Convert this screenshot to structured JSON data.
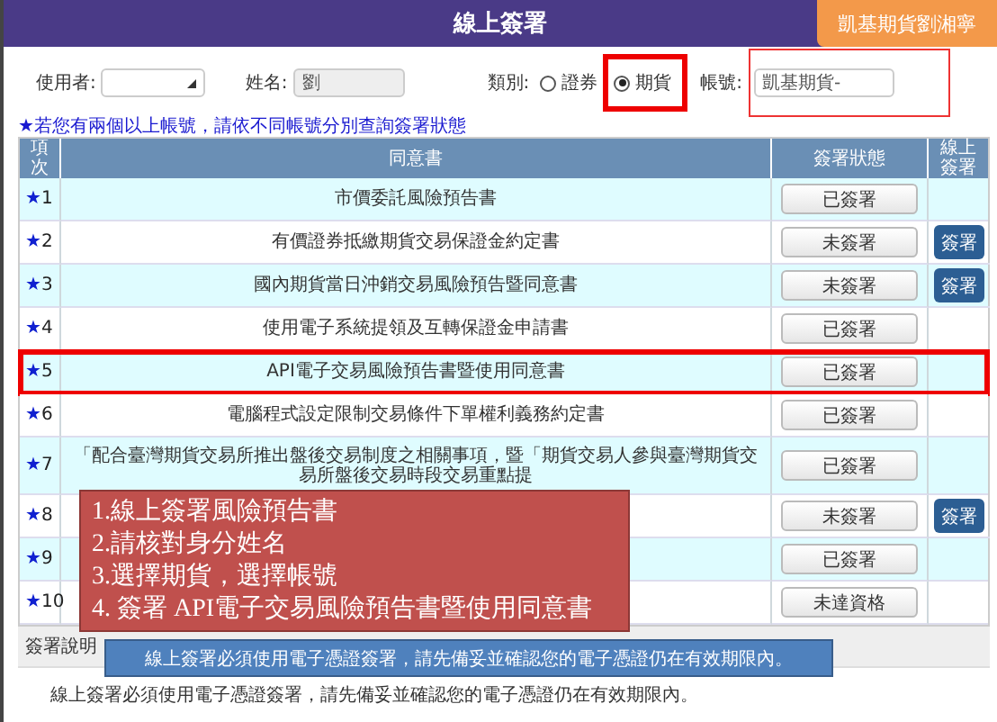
{
  "header": {
    "title": "線上簽署",
    "badge": "凱基期貨劉湘寧"
  },
  "form": {
    "user_label": "使用者:",
    "name_label": "姓名:",
    "name_value": "劉",
    "category_label": "類別:",
    "categories": [
      {
        "label": "證券",
        "selected": false,
        "highlighted": false
      },
      {
        "label": "期貨",
        "selected": true,
        "highlighted": true
      }
    ],
    "account_label": "帳號:",
    "account_value": "凱基期貨-",
    "account_highlighted": true
  },
  "note": "★若您有兩個以上帳號，請依不同帳號分別查詢簽署狀態",
  "table": {
    "columns": [
      "項次",
      "同意書",
      "簽署狀態",
      "線上簽署"
    ],
    "rows": [
      {
        "marker": "★",
        "index": "1",
        "document": "市價委託風險預告書",
        "status": "已簽署",
        "highlighted": false
      },
      {
        "marker": "★",
        "index": "2",
        "document": "有價證券抵繳期貨交易保證金約定書",
        "status": "未簽署",
        "action": "簽署",
        "highlighted": false
      },
      {
        "marker": "★",
        "index": "3",
        "document": "國內期貨當日沖銷交易風險預告暨同意書",
        "status": "未簽署",
        "action": "簽署",
        "highlighted": false
      },
      {
        "marker": "★",
        "index": "4",
        "document": "使用電子系統提領及互轉保證金申請書",
        "status": "已簽署",
        "highlighted": false
      },
      {
        "marker": "★",
        "index": "5",
        "document": "API電子交易風險預告書暨使用同意書",
        "status": "已簽署",
        "highlighted": true
      },
      {
        "marker": "★",
        "index": "6",
        "document": "電腦程式設定限制交易條件下單權利義務約定書",
        "status": "已簽署",
        "highlighted": false
      },
      {
        "marker": "★",
        "index": "7",
        "document": "「配合臺灣期貨交易所推出盤後交易制度之相關事項，暨「期貨交易人參與臺灣期貨交易所盤後交易時段交易重點提",
        "status": "已簽署",
        "highlighted": false
      },
      {
        "marker": "★",
        "index": "8",
        "status": "未簽署",
        "action": "簽署",
        "highlighted": false
      },
      {
        "marker": "★",
        "index": "9",
        "status": "已簽署",
        "highlighted": false
      },
      {
        "marker": "★",
        "index": "10",
        "status": "未達資格",
        "highlighted": false
      }
    ]
  },
  "explanation": {
    "title": "簽署說明",
    "text": "線上簽署必須使用電子憑證簽署，請先備妥並確認您的電子憑證仍在有效期限內。"
  },
  "callouts": {
    "steps": [
      "1.線上簽署風險預告書",
      "2.請核對身分姓名",
      "3.選擇期貨，選擇帳號",
      "4. 簽署  API電子交易風險預告書暨使用同意書"
    ],
    "tip": "線上簽署必須使用電子憑證簽署，請先備妥並確認您的電子憑證仍在有效期限內。"
  }
}
